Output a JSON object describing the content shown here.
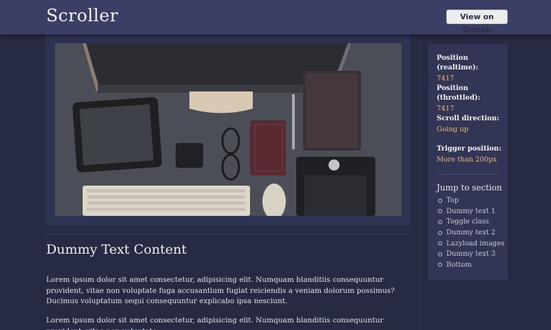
{
  "header": {
    "brand": "Scroller",
    "github_button": "View on Github"
  },
  "content": {
    "title": "Dummy Text Content",
    "paragraphs": [
      "Lorem ipsum dolor sit amet consectetur, adipisicing elit. Numquam blanditiis consequuntur provident, vitae non voluptate fuga accusantium fugiat reiciendis a veniam dolorum possimus? Ducimus voluptatum sequi consequuntur explicabo ipsa nesciunt.",
      "Lorem ipsum dolor sit amet consectetur, adipisicing elit. Numquam blanditiis consequuntur provident, vitae non voluptate"
    ]
  },
  "sidebar": {
    "stats": [
      {
        "label": "Position (realtime):",
        "value": "7417"
      },
      {
        "label": "Position (throttled):",
        "value": "7417"
      },
      {
        "label": "Scroll direction:",
        "value": "Going up"
      },
      {
        "label": "Trigger position:",
        "value": "More than 200px"
      }
    ],
    "jump_title": "Jump to section",
    "jump_items": [
      "Top",
      "Dummy text 1",
      "Toggle class",
      "Dummy text 2",
      "Lazyload images",
      "Dummy text 3",
      "Bottom"
    ]
  },
  "colors": {
    "background": "#262a42",
    "header": "#3b3f66",
    "sidebar": "#323553",
    "accent_value": "#e4b88a"
  }
}
